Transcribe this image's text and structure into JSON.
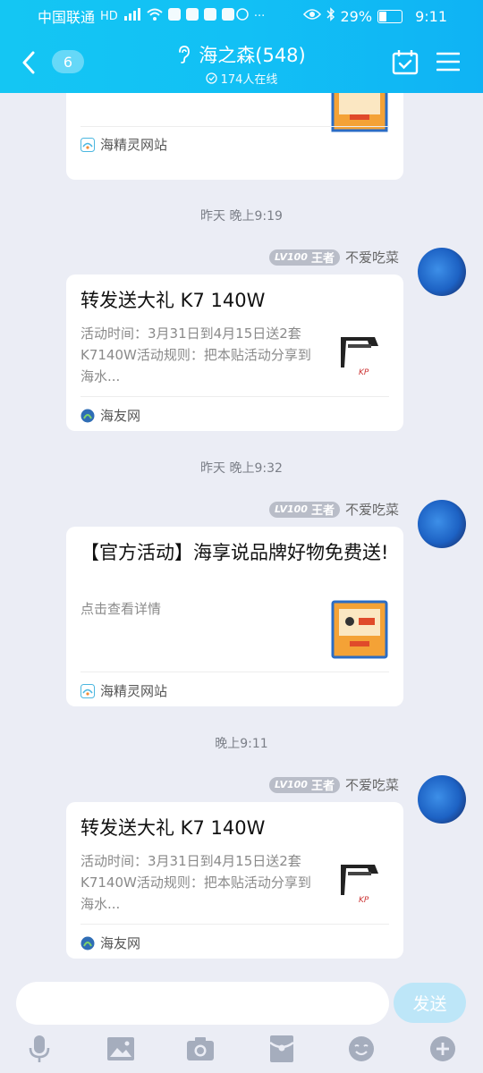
{
  "status_bar": {
    "carrier": "中国联通",
    "battery": "29%",
    "time": "9:11"
  },
  "nav": {
    "unread_count": "6",
    "group_title": "海之森(548)",
    "online": "174人在线"
  },
  "messages": [
    {
      "card": {
        "source": "海精灵网站"
      }
    },
    {
      "time": "昨天 晚上9:19",
      "level": "LV100",
      "rank": "王者",
      "sender": "不爱吃菜",
      "card": {
        "title": "转发送大礼 K7 140W",
        "desc": "活动时间：3月31日到4月15日送2套K7140W活动规则：把本贴活动分享到海水...",
        "source": "海友网"
      }
    },
    {
      "time": "昨天 晚上9:32",
      "level": "LV100",
      "rank": "王者",
      "sender": "不爱吃菜",
      "card": {
        "title": "【官方活动】海享说品牌好物免费送!",
        "desc": "点击查看详情",
        "source": "海精灵网站"
      }
    },
    {
      "time": "晚上9:11",
      "level": "LV100",
      "rank": "王者",
      "sender": "不爱吃菜",
      "card": {
        "title": "转发送大礼 K7 140W",
        "desc": "活动时间：3月31日到4月15日送2套K7140W活动规则：把本贴活动分享到海水...",
        "source": "海友网"
      }
    }
  ],
  "input": {
    "placeholder": "",
    "send_label": "发送"
  },
  "toolbar": [
    "mic-icon",
    "image-icon",
    "camera-icon",
    "red-packet-icon",
    "emoji-icon",
    "plus-icon"
  ]
}
